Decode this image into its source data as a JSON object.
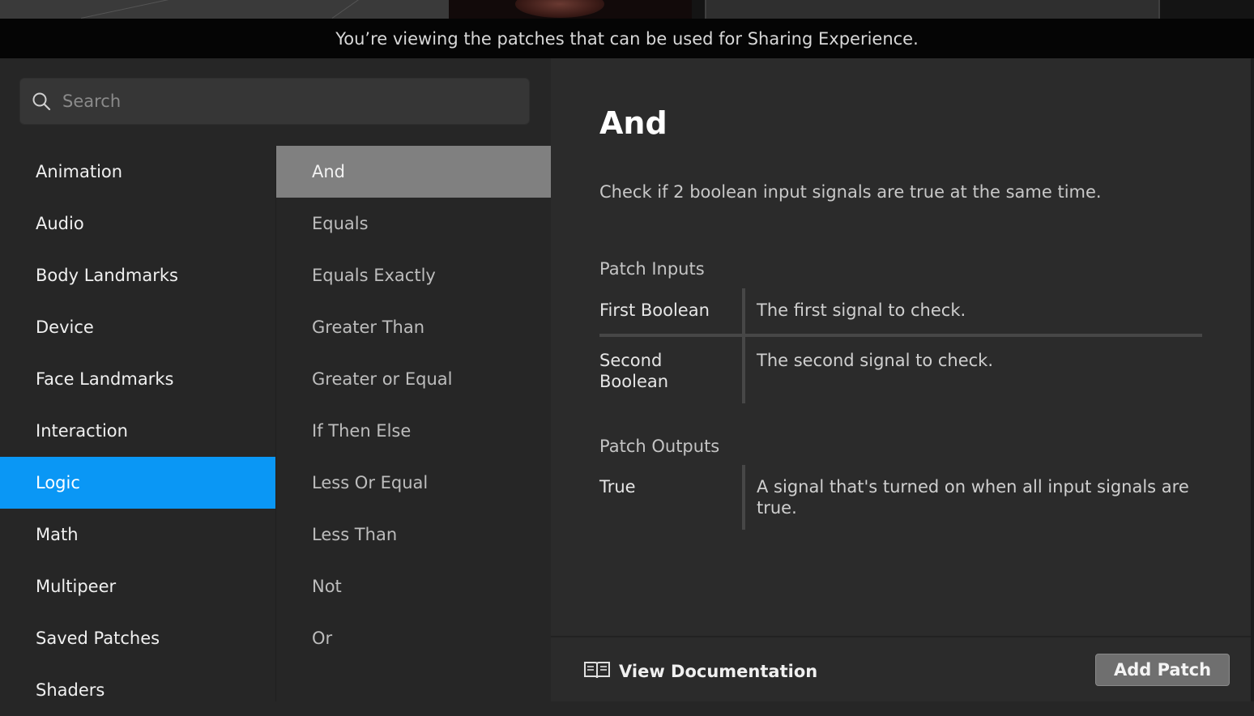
{
  "banner": {
    "text": "You’re viewing the patches that can be used for Sharing Experience."
  },
  "search": {
    "placeholder": "Search",
    "value": ""
  },
  "categories": [
    {
      "label": "Animation"
    },
    {
      "label": "Audio"
    },
    {
      "label": "Body Landmarks"
    },
    {
      "label": "Device"
    },
    {
      "label": "Face Landmarks"
    },
    {
      "label": "Interaction"
    },
    {
      "label": "Logic",
      "selected": true
    },
    {
      "label": "Math"
    },
    {
      "label": "Multipeer"
    },
    {
      "label": "Saved Patches"
    },
    {
      "label": "Shaders"
    }
  ],
  "patches": [
    {
      "label": "And",
      "selected": true
    },
    {
      "label": "Equals"
    },
    {
      "label": "Equals Exactly"
    },
    {
      "label": "Greater Than"
    },
    {
      "label": "Greater or Equal"
    },
    {
      "label": "If Then Else"
    },
    {
      "label": "Less Or Equal"
    },
    {
      "label": "Less Than"
    },
    {
      "label": "Not"
    },
    {
      "label": "Or"
    }
  ],
  "detail": {
    "title": "And",
    "description": "Check if 2 boolean input signals are true at the same time.",
    "inputs_heading": "Patch Inputs",
    "inputs": [
      {
        "name": "First Boolean",
        "description": "The first signal to check."
      },
      {
        "name": "Second Boolean",
        "description": "The second signal to check."
      }
    ],
    "outputs_heading": "Patch Outputs",
    "outputs": [
      {
        "name": "True",
        "description": "A signal that's turned on when all input signals are true."
      }
    ]
  },
  "footer": {
    "view_doc_label": "View Documentation",
    "add_patch_label": "Add Patch"
  },
  "colors": {
    "selected_category": "#0a97f5",
    "selected_patch": "#808080",
    "add_patch_button": "#6f6f6f"
  },
  "icons": {
    "search": "search-icon",
    "documentation": "book-icon"
  }
}
